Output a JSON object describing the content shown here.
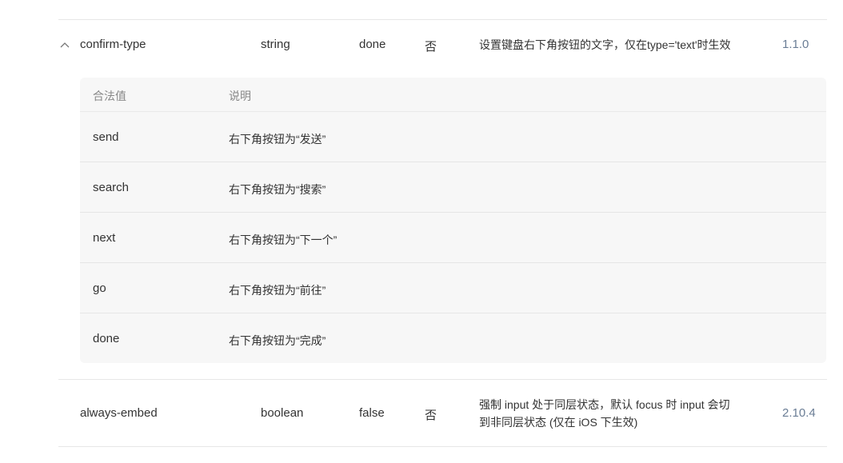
{
  "row1": {
    "name": "confirm-type",
    "type": "string",
    "default": "done",
    "required": "否",
    "description": "设置键盘右下角按钮的文字，仅在type='text'时生效",
    "version": "1.1.0"
  },
  "subtable": {
    "headers": [
      "合法值",
      "说明"
    ],
    "rows": [
      {
        "value": "send",
        "desc": "右下角按钮为“发送”"
      },
      {
        "value": "search",
        "desc": "右下角按钮为“搜索”"
      },
      {
        "value": "next",
        "desc": "右下角按钮为“下一个”"
      },
      {
        "value": "go",
        "desc": "右下角按钮为“前往”"
      },
      {
        "value": "done",
        "desc": "右下角按钮为“完成”"
      }
    ]
  },
  "row2": {
    "name": "always-embed",
    "type": "boolean",
    "default": "false",
    "required": "否",
    "description_line1": "强制 input 处于同层状态，默认 focus 时 input 会切",
    "description_line2": "到非同层状态 (仅在 iOS 下生效)",
    "version": "2.10.4"
  },
  "icons": {
    "collapse": "chevron-up-icon"
  }
}
